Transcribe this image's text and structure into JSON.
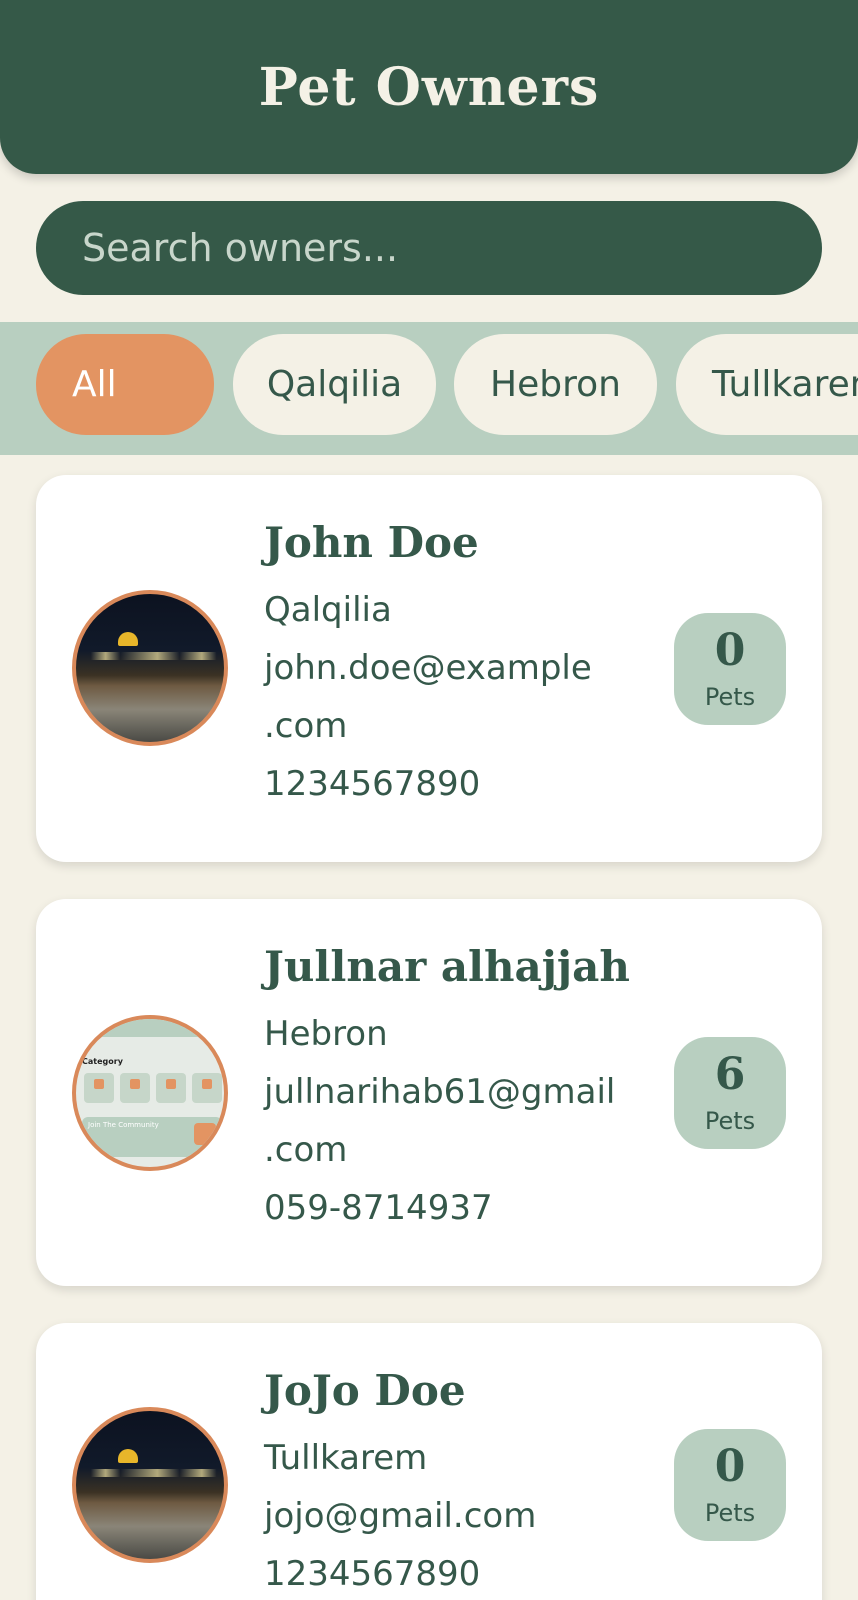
{
  "header": {
    "title": "Pet Owners"
  },
  "search": {
    "placeholder": "Search owners..."
  },
  "filters": [
    "All",
    "Qalqilia",
    "Hebron",
    "Tullkarem"
  ],
  "owners": [
    {
      "name": "John Doe",
      "city": "Qalqilia",
      "email_line1": "john.doe@example",
      "email_line2": ".com",
      "phone": "1234567890",
      "pets_count": "0",
      "pets_label": "Pets"
    },
    {
      "name": "Jullnar alhajjah",
      "city": "Hebron",
      "email_line1": "jullnarihab61@gmail",
      "email_line2": ".com",
      "phone": "059-8714937",
      "pets_count": "6",
      "pets_label": "Pets"
    },
    {
      "name": "JoJo Doe",
      "city": "Tullkarem",
      "email_line1": "jojo@gmail.com",
      "email_line2": "",
      "phone": "1234567890",
      "pets_count": "0",
      "pets_label": "Pets"
    }
  ],
  "avatar_thumb": {
    "category_label": "Category",
    "banner_text": "Join The Community"
  },
  "colors": {
    "primary": "#355948",
    "accent": "#e39462",
    "chip_bar": "#b8cfc0",
    "background": "#f4f1e6"
  }
}
